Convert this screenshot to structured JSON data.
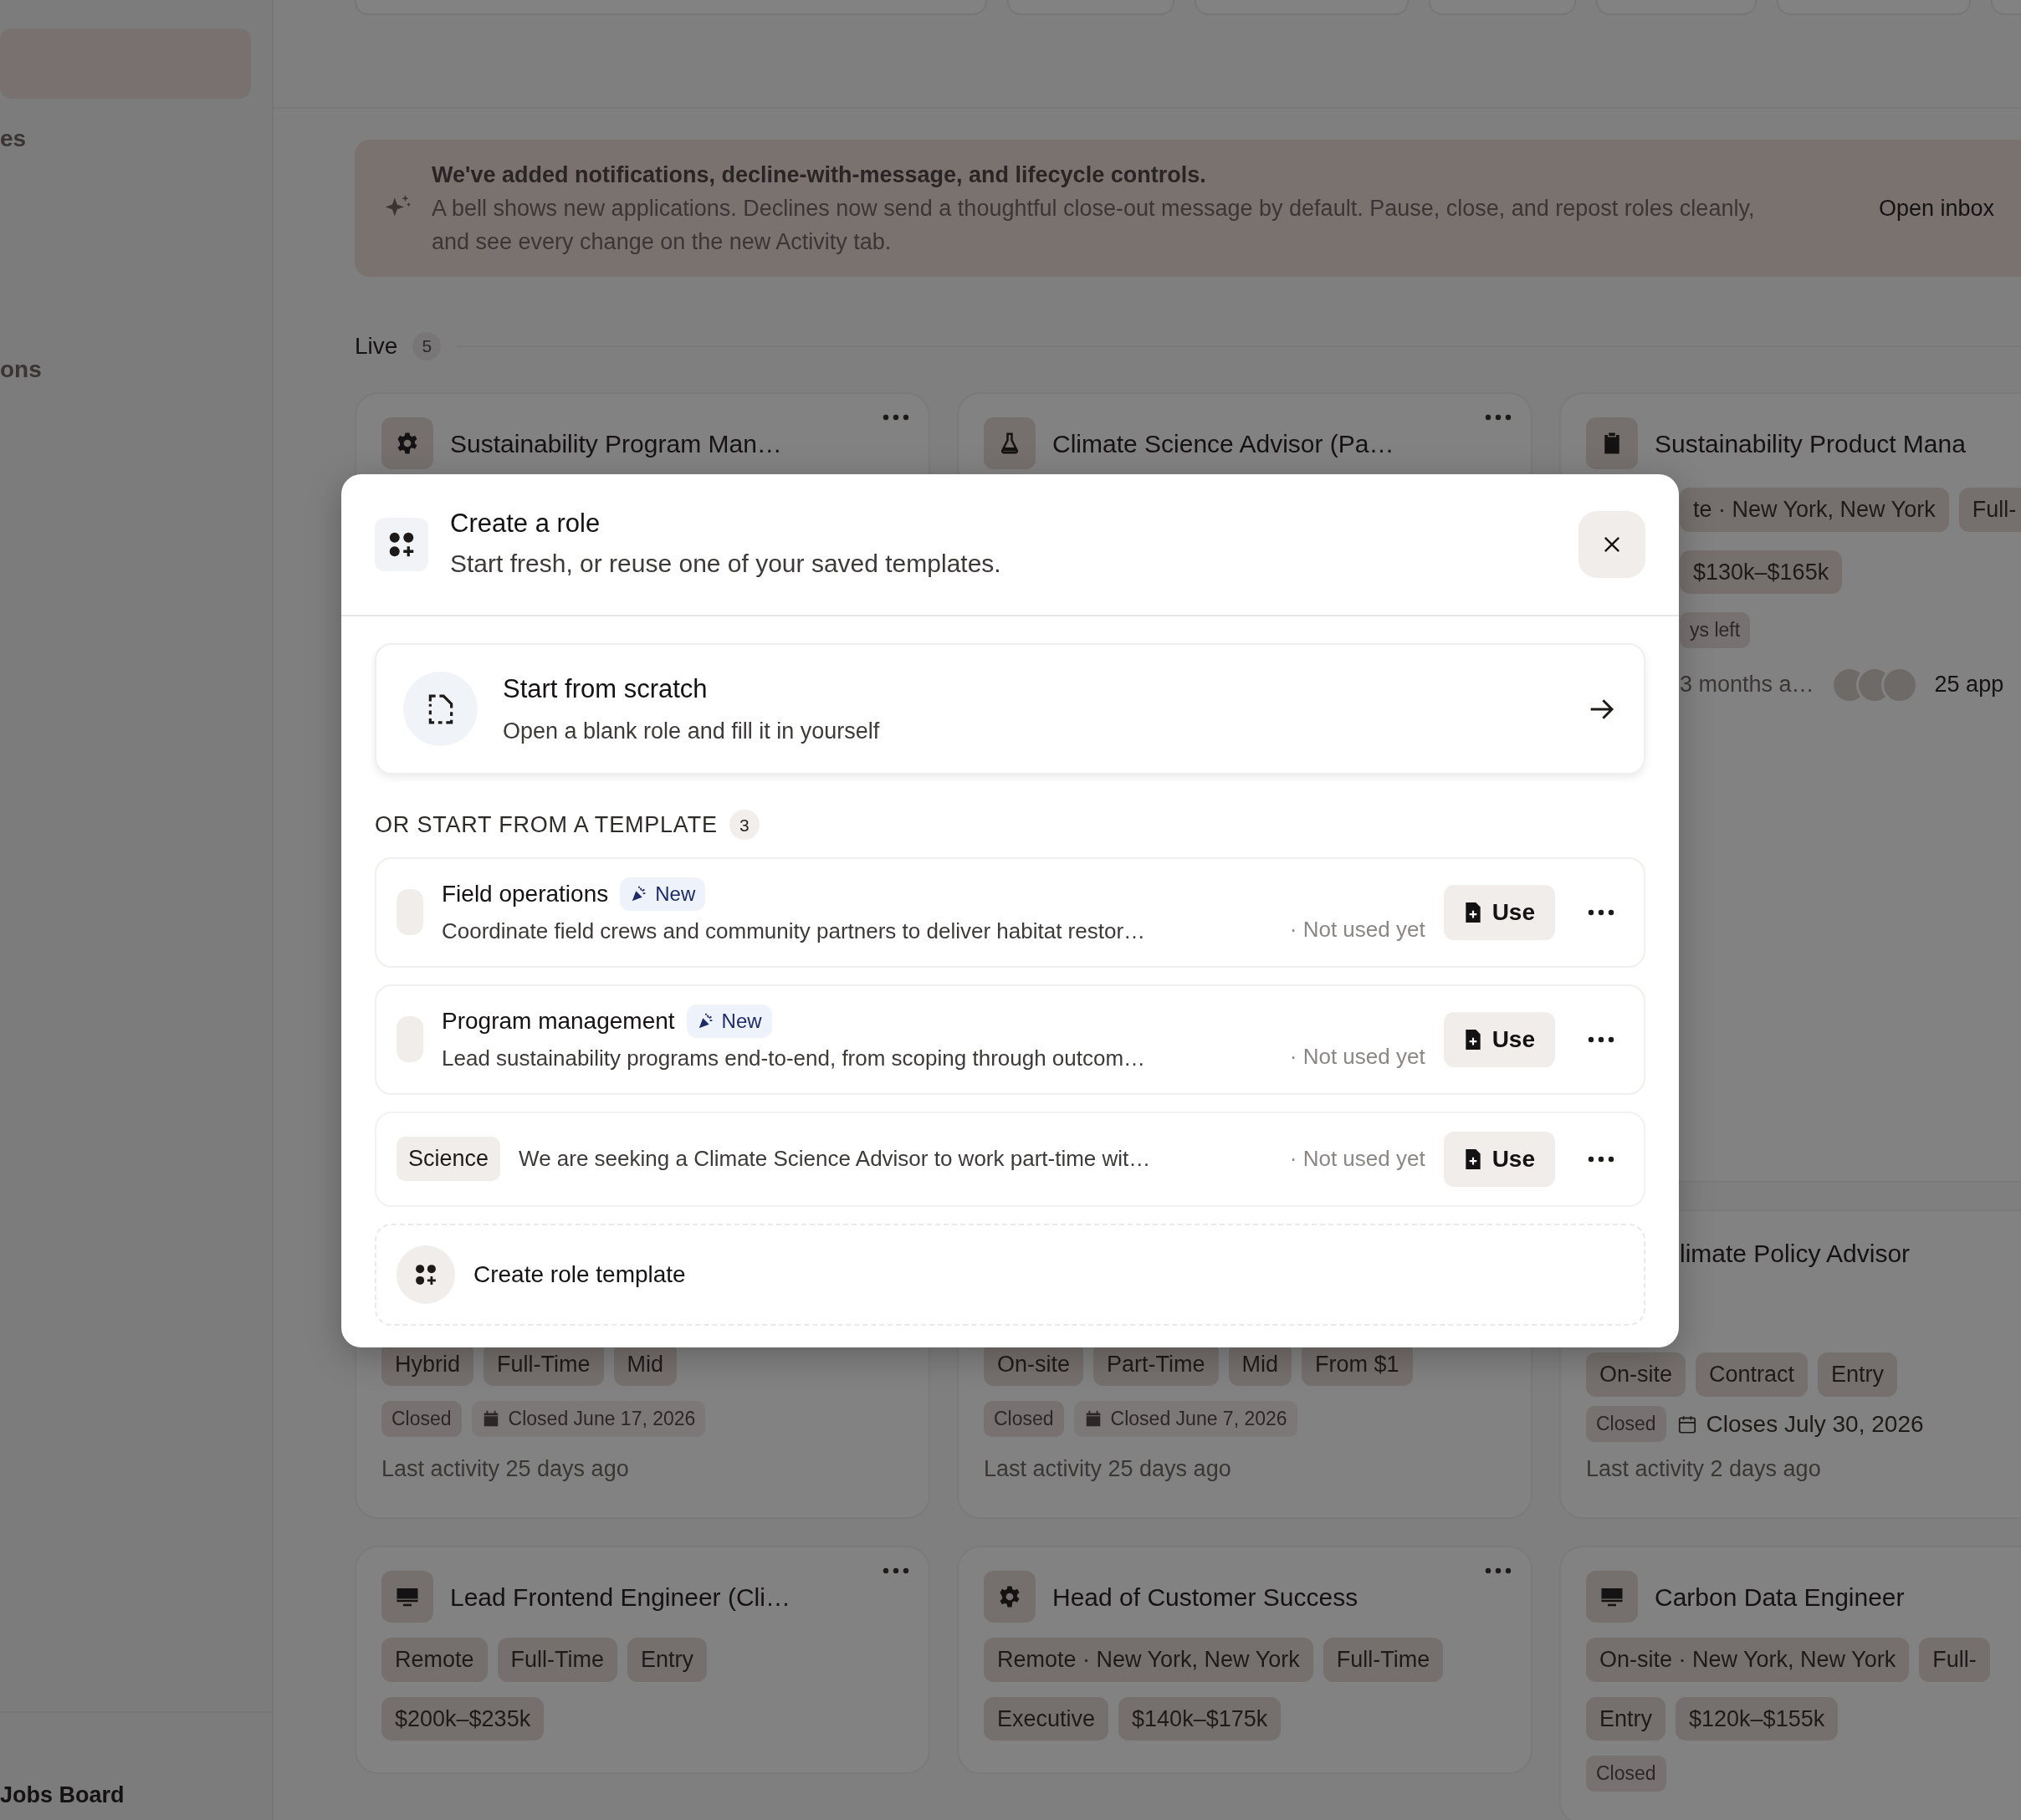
{
  "sidebar": {
    "items": [
      {
        "selected": true
      },
      {
        "label": "es",
        "selected": false
      },
      {
        "label": "ons",
        "selected": false
      }
    ],
    "footer": "Jobs Board"
  },
  "banner": {
    "title": "We've added notifications, decline-with-message, and lifecycle controls.",
    "body": "A bell shows new applications. Declines now send a thoughtful close-out message by default. Pause, close, and repost roles cleanly, and see every change on the new Activity tab.",
    "link": "Open inbox"
  },
  "section": {
    "label": "Live",
    "count": "5"
  },
  "columns": [
    [
      {
        "kind": "gear",
        "title": "Sustainability Program Man…",
        "menu": true,
        "lines": [
          {
            "kind": "tags",
            "items": [
              "Hybrid",
              "Full-Time",
              "Mid"
            ]
          },
          {
            "kind": "status",
            "badge": "Closed",
            "date": {
              "kind": "filled",
              "text": "Closed June 17, 2026"
            }
          },
          {
            "kind": "activity",
            "text": "Last activity 25 days ago"
          }
        ]
      },
      {
        "kind": "monitor",
        "title": "Lead Frontend Engineer (Cli…",
        "menu": true,
        "lines": [
          {
            "kind": "tags",
            "items": [
              "Remote",
              "Full-Time",
              "Entry"
            ]
          },
          {
            "kind": "tags",
            "items": [
              "$200k–$235k"
            ]
          }
        ]
      }
    ],
    [
      {
        "kind": "flask",
        "title": "Climate Science Advisor (Pa…",
        "menu": true,
        "lines": [
          {
            "kind": "tags",
            "items": [
              "On-site",
              "Part-Time",
              "Mid",
              "From $1"
            ]
          },
          {
            "kind": "status",
            "badge": "Closed",
            "date": {
              "kind": "filled",
              "text": "Closed June 7, 2026"
            }
          },
          {
            "kind": "activity",
            "text": "Last activity 25 days ago"
          }
        ]
      },
      {
        "kind": "gear",
        "title": "Head of Customer Success",
        "menu": true,
        "lines": [
          {
            "kind": "tags",
            "items": [
              "Remote · New York, New York",
              "Full-Time"
            ]
          },
          {
            "kind": "tags",
            "items": [
              "Executive",
              "$140k–$175k"
            ]
          }
        ]
      }
    ],
    [
      {
        "kind": "clipboard",
        "title": "Sustainability Product Mana",
        "menu": false,
        "lines": [
          {
            "kind": "tags",
            "items": [
              "te · New York, New York",
              "Full-"
            ]
          },
          {
            "kind": "tags",
            "items": [
              "$130k–$165k"
            ]
          },
          {
            "kind": "badge",
            "text": "ys left"
          },
          {
            "kind": "applicants",
            "time": "3 months a…",
            "avatars": [
              {
                "kind": "photo"
              },
              {
                "kind": "photo"
              },
              {
                "kind": "photo"
              }
            ],
            "count": "25 app"
          }
        ]
      },
      {
        "kind": "none",
        "title": "limate Policy Advisor",
        "menu": false,
        "lines": [
          {
            "kind": "tags",
            "items": [
              "On-site",
              "Contract",
              "Entry"
            ]
          },
          {
            "kind": "status",
            "badge": "Closed",
            "date": {
              "kind": "outline",
              "text": "Closes July 30, 2026"
            }
          },
          {
            "kind": "activity",
            "text": "Last activity 2 days ago"
          }
        ]
      },
      {
        "kind": "monitor",
        "title": "Carbon Data Engineer",
        "menu": false,
        "lines": [
          {
            "kind": "tags",
            "items": [
              "On-site · New York, New York",
              "Full-"
            ]
          },
          {
            "kind": "tags",
            "items": [
              "Entry",
              "$120k–$155k"
            ]
          },
          {
            "kind": "badge",
            "text": "Closed"
          }
        ]
      }
    ]
  ],
  "modal": {
    "title": "Create a role",
    "subtitle": "Start fresh, or reuse one of your saved templates.",
    "scratch": {
      "title": "Start from scratch",
      "subtitle": "Open a blank role and fill it in yourself"
    },
    "templates_heading": "OR START FROM A TEMPLATE",
    "templates_count": "3",
    "templates": [
      {
        "title": "Field operations",
        "new": true,
        "new_label": "New",
        "description": "Coordinate field crews and community partners to deliver habitat restor…",
        "usage": "· Not used yet",
        "action": "Use"
      },
      {
        "title": "Program management",
        "new": true,
        "new_label": "New",
        "description": "Lead sustainability programs end-to-end, from scoping through outcom…",
        "usage": "· Not used yet",
        "action": "Use"
      },
      {
        "category": "Science",
        "description": "We are seeking a Climate Science Advisor to work part-time wit…",
        "usage": "· Not used yet",
        "action": "Use"
      }
    ],
    "create_template": "Create role template"
  }
}
